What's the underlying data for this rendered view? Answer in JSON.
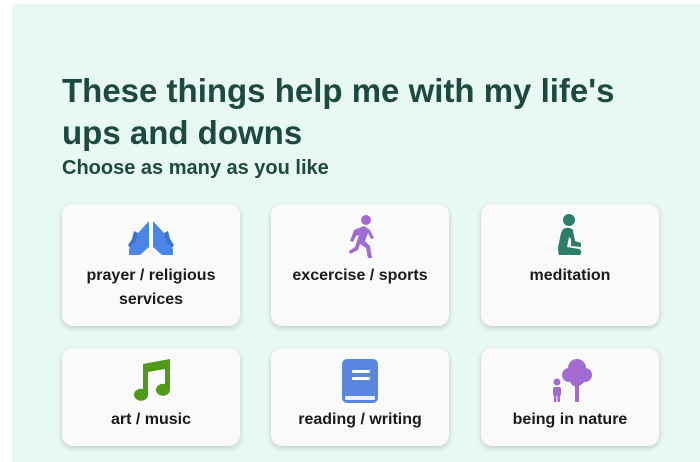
{
  "header": {
    "title": "These things help me with my life's ups and downs",
    "subtitle": "Choose as many as you like"
  },
  "cards": [
    {
      "label": "prayer / religious services",
      "icon": "praying-hands-icon",
      "color": "#4a86e8"
    },
    {
      "label": "excercise / sports",
      "icon": "running-person-icon",
      "color": "#a26bd1"
    },
    {
      "label": "meditation",
      "icon": "meditating-person-icon",
      "color": "#2e7d6b"
    },
    {
      "label": "art / music",
      "icon": "music-note-icon",
      "color": "#4f9a17"
    },
    {
      "label": "reading / writing",
      "icon": "book-icon",
      "color": "#5a86e0"
    },
    {
      "label": "being in nature",
      "icon": "tree-person-icon",
      "color": "#a26bd1"
    }
  ],
  "colors": {
    "background": "#e8f8f2",
    "heading": "#1d4a40",
    "card": "#fafafa"
  }
}
